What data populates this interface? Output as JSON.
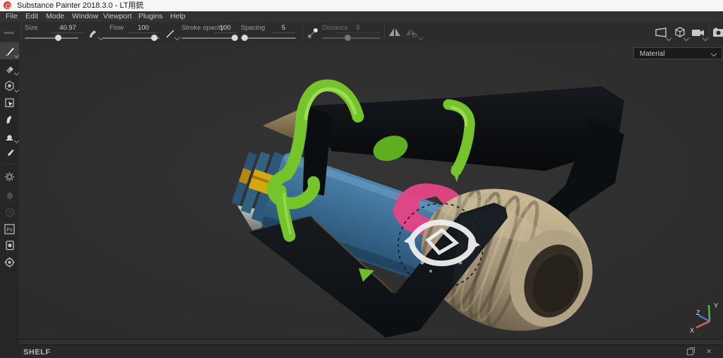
{
  "window": {
    "title": "Substance Painter 2018.3.0 - LT用銃",
    "app_icon": "substance-painter-logo"
  },
  "menubar": [
    "File",
    "Edit",
    "Mode",
    "Window",
    "Viewport",
    "Plugins",
    "Help"
  ],
  "toolbar": {
    "size_label": "Size",
    "size_value": "40.97",
    "size_percent": 62,
    "flow_label": "Flow",
    "flow_value": "100",
    "flow_percent": 90,
    "stroke_opacity_label": "Stroke opacity",
    "stroke_opacity_value": "100",
    "stroke_opacity_percent": 96,
    "spacing_label": "Spacing",
    "spacing_value": "5",
    "spacing_percent": 6,
    "distance_label": "Distance",
    "distance_value": "8",
    "distance_percent": 44,
    "distance_disabled": true,
    "icons": [
      "brush-preset",
      "stroke-preset",
      "lazy-mouse",
      "symmetry",
      "symmetry-settings",
      "perspective-view",
      "mesh-display",
      "camera-view",
      "screenshot-camera"
    ]
  },
  "sidebar": {
    "tools": [
      {
        "name": "paint-tool",
        "selected": true
      },
      {
        "name": "eraser-tool",
        "selected": false
      },
      {
        "name": "projection-tool",
        "selected": false
      },
      {
        "name": "polygon-fill-tool",
        "selected": false
      },
      {
        "name": "smudge-tool",
        "selected": false
      },
      {
        "name": "clone-tool",
        "selected": false
      },
      {
        "name": "color-picker-tool",
        "selected": false
      },
      {
        "name": "particles-tool",
        "selected": false
      },
      {
        "name": "notifications",
        "selected": false,
        "disabled": true
      },
      {
        "name": "substance-share",
        "selected": false,
        "disabled": true
      },
      {
        "name": "photoshop-export",
        "selected": false
      },
      {
        "name": "display-settings",
        "selected": false
      },
      {
        "name": "viewer-settings",
        "selected": false
      }
    ]
  },
  "viewport": {
    "material_mode": "Material",
    "axis": {
      "x": "X",
      "y": "Y",
      "z": "Z"
    },
    "model": "splatoon-style blaster: blue cylinder body, tan corrugated nozzle, black handle, green tubes, pink and white paint splats, dashed brush cursor"
  },
  "shelf": {
    "title": "SHELF"
  },
  "colors": {
    "accent_red": "#e23b2e",
    "axis_x": "#d96459",
    "axis_y": "#57b84e",
    "axis_z": "#4a7bd0",
    "body_blue": "#3a6f99",
    "tube_green": "#79c62c",
    "hose_tan": "#b3a384",
    "splat_pink": "#e64486",
    "splat_white": "#efefef"
  }
}
